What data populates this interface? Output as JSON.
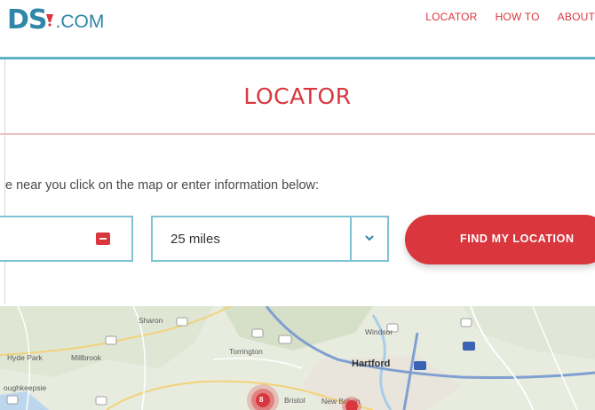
{
  "header": {
    "logo_main": "DS",
    "logo_suffix": ".COM",
    "nav": [
      "LOCATOR",
      "HOW TO",
      "ABOUT"
    ]
  },
  "page_title": "LOCATOR",
  "instructions": "e near you click on the map or enter information below:",
  "search": {
    "address_value": "",
    "radius_value": "25 miles",
    "find_button": "FIND MY LOCATION"
  },
  "map": {
    "places": [
      "Sharon",
      "Windsor",
      "Hyde Park",
      "Millbrook",
      "Torrington",
      "Hartford",
      "oughkeepsie",
      "Bristol",
      "New Britain"
    ],
    "cluster_count": "8"
  },
  "colors": {
    "accent_red": "#d9363e",
    "accent_blue": "#2f86a8",
    "rule_blue": "#5fb3c8"
  }
}
